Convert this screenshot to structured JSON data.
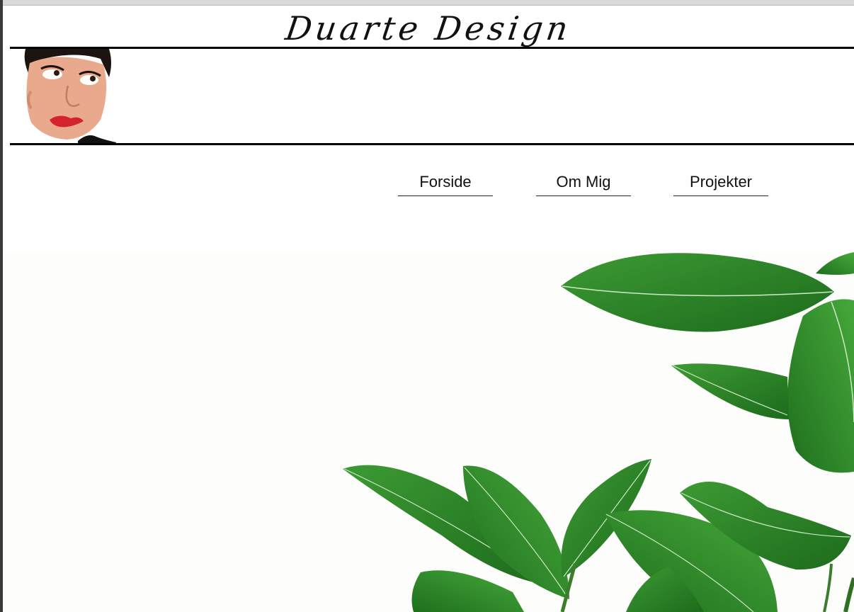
{
  "site": {
    "title": "Duarte Design"
  },
  "nav": {
    "items": [
      {
        "label": "Forside"
      },
      {
        "label": "Om Mig"
      },
      {
        "label": "Projekter"
      }
    ]
  },
  "colors": {
    "leaf": "#2f8a2a",
    "leaf_dark": "#1f6a1d",
    "vein": "#cfe8c8",
    "rule": "#000000"
  },
  "icons": {
    "portrait": "portrait-image",
    "hero": "plant-leaves-image"
  }
}
